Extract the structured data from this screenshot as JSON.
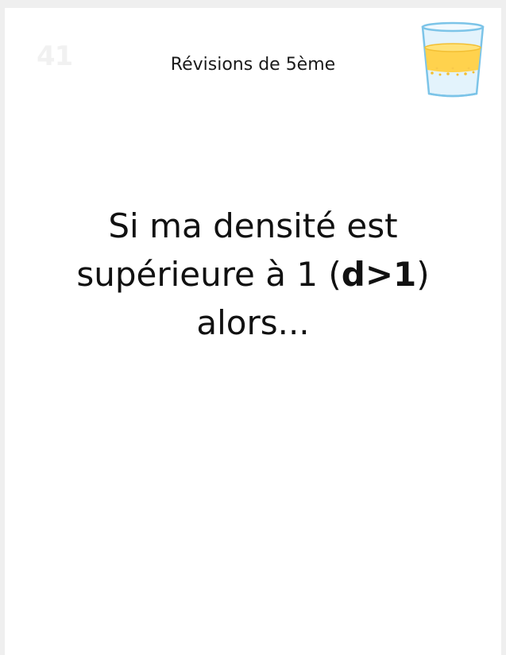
{
  "card": {
    "number": "41",
    "subject": "Révisions de 5ème",
    "icon": "glass-of-liquid-icon"
  },
  "question": {
    "line1": "Si ma densité est",
    "line2_prefix": "supérieure à 1 (",
    "line2_bold": "d>1",
    "line2_suffix": ")",
    "line3": "alors..."
  },
  "colors": {
    "background": "#efefef",
    "card": "#ffffff",
    "glass_outline": "#7cc4e8",
    "liquid": "#ffd24d"
  }
}
